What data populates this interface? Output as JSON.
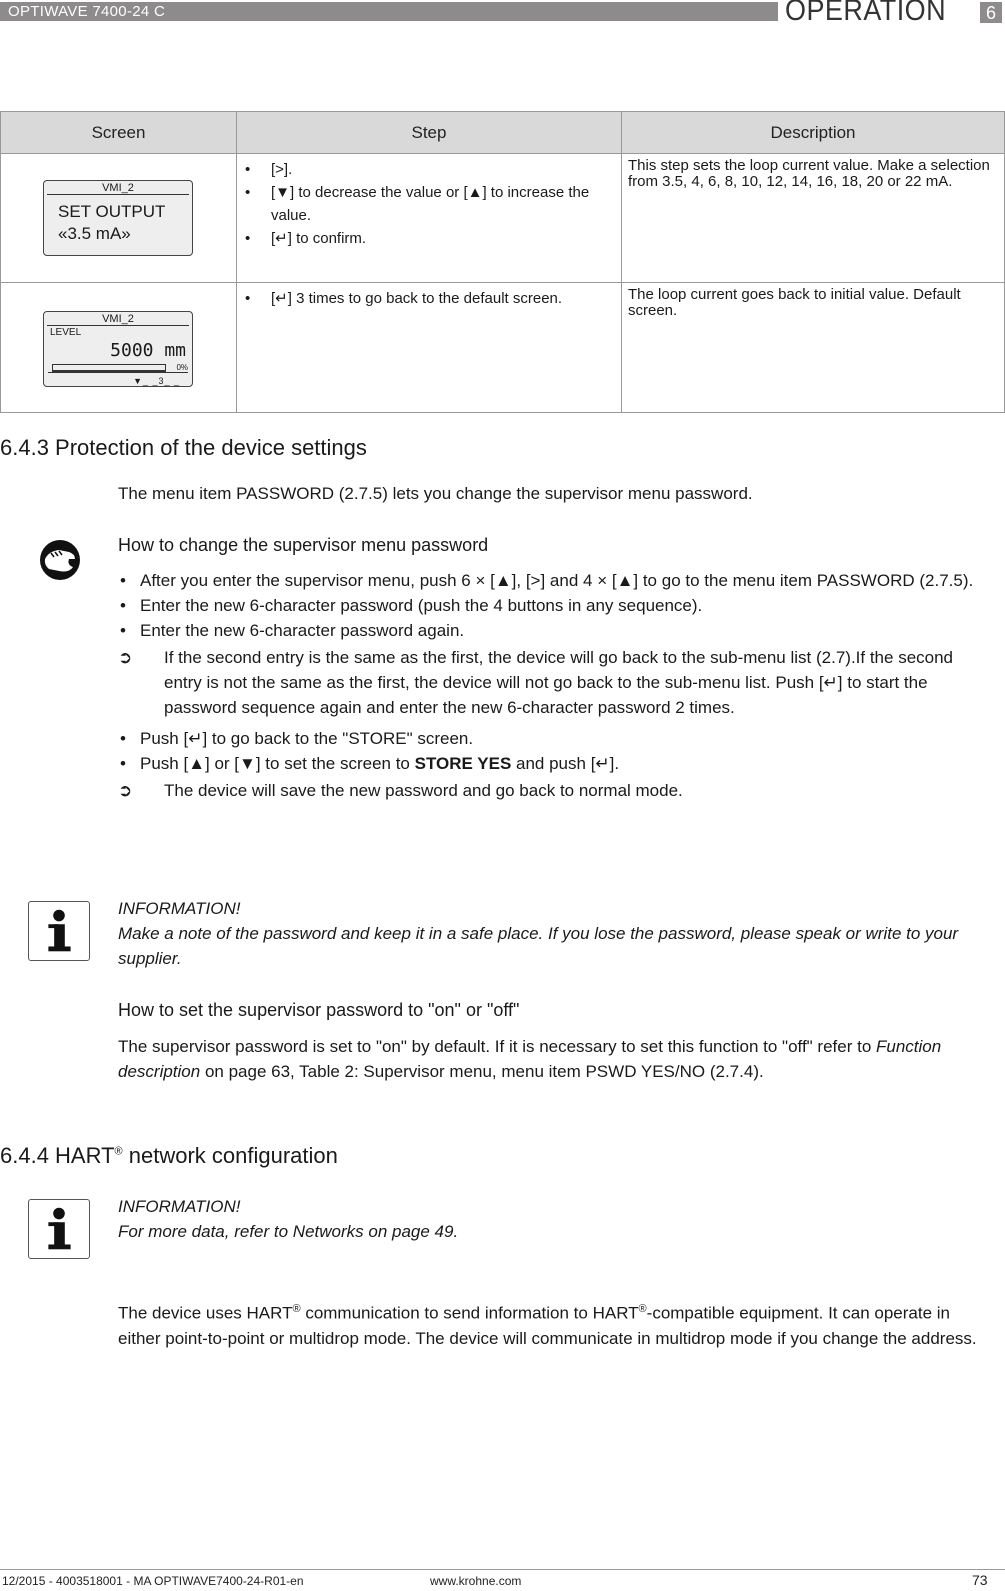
{
  "header": {
    "product": "OPTIWAVE 7400-24 C",
    "chapter_title": "OPERATION",
    "chapter_number": "6"
  },
  "table": {
    "columns": [
      "Screen",
      "Step",
      "Description"
    ],
    "rows": [
      {
        "screen": {
          "title": "VMI_2",
          "line1": "SET OUTPUT",
          "line2": "«3.5 mA»"
        },
        "steps": [
          "[>].",
          "[▼] to decrease the value or [▲] to increase the value.",
          "[↵] to confirm."
        ],
        "description": "This step sets the loop current value. Make a selection from 3.5, 4, 6, 8, 10, 12, 14, 16, 18, 20 or 22 mA."
      },
      {
        "screen": {
          "title": "VMI_2",
          "label": "LEVEL",
          "value": "5000 mm",
          "percent": "0%",
          "footer": "▼_ _3_ _"
        },
        "steps": [
          "[↵] 3 times to go back to the default screen."
        ],
        "description": "The loop current goes back to initial value. Default screen."
      }
    ]
  },
  "section_643": {
    "heading": "6.4.3  Protection of the device settings",
    "intro": "The menu item PASSWORD (2.7.5) lets you change the supervisor menu password.",
    "procedure_title": "How to change the supervisor  menu password",
    "bullets_a": [
      "After you enter the supervisor menu, push 6 × [▲], [>] and 4 × [▲] to go to the menu item PASSWORD (2.7.5).",
      "Enter the new 6-character password (push the 4 buttons in any sequence).",
      "Enter the new 6-character password again."
    ],
    "result_a": "If the second entry is the same as the first, the device will go back to the sub-menu list (2.7).If the second entry is not the same as the first, the device will not go back to the sub-menu list. Push [↵] to start the password sequence again and enter the new 6-character password 2 times.",
    "bullet_b1": "Push [↵] to go back to the \"STORE\" screen.",
    "bullet_b2_pre": "Push [▲] or [▼] to set the screen to ",
    "bullet_b2_bold": "STORE YES",
    "bullet_b2_post": " and push [↵].",
    "result_b": "The device will save the new password and go back to normal mode.",
    "info_title": "INFORMATION!",
    "info_text": "Make a note of the password and keep it in a safe place. If you lose the password, please speak or write to your supplier.",
    "onoff_title": "How to set the supervisor password to \"on\" or \"off\"",
    "onoff_pre": "The supervisor password is set to \"on\" by default. If it is necessary to set  this function to \"off\" refer to ",
    "onoff_italic": "Function description",
    "onoff_post": " on page 63, Table 2: Supervisor menu, menu item PSWD YES/NO (2.7.4)."
  },
  "section_644": {
    "heading_pre": "6.4.4  HART",
    "heading_sup": "®",
    "heading_post": " network configuration",
    "info_title": "INFORMATION!",
    "info_text": "For more data, refer to Networks on page 49.",
    "body_1": "The device uses HART",
    "body_sup1": "®",
    "body_2": " communication to send information to HART",
    "body_sup2": "®",
    "body_3": "-compatible equipment. It can operate in either point-to-point or multidrop mode. The device will communicate in multidrop mode if you change the address."
  },
  "footer": {
    "doc_id": "12/2015 - 4003518001 - MA OPTIWAVE7400-24-R01-en",
    "website": "www.krohne.com",
    "page_number": "73"
  },
  "icons": {
    "result_arrow": "➲",
    "info": "info-icon",
    "hand": "hand-action-icon"
  }
}
